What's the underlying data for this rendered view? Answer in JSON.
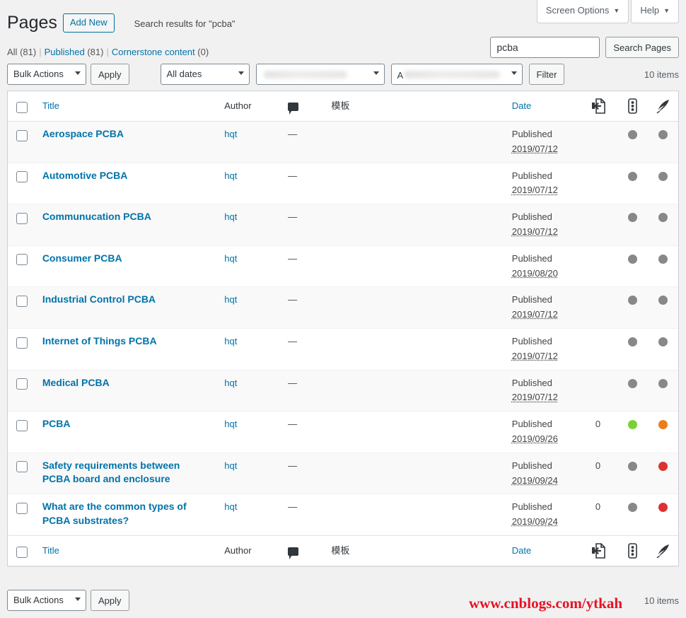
{
  "screen_meta": {
    "screen_options_label": "Screen Options",
    "help_label": "Help",
    "caret": "▼"
  },
  "header": {
    "title": "Pages",
    "add_new_label": "Add New",
    "search_result_note": "Search results for \"pcba\""
  },
  "status_links": {
    "all_label": "All",
    "all_count": "(81)",
    "published_label": "Published",
    "published_count": "(81)",
    "cornerstone_label": "Cornerstone content",
    "cornerstone_count": "(0)",
    "separator": "|"
  },
  "search": {
    "value": "pcba",
    "placeholder": "",
    "submit_label": "Search Pages"
  },
  "tablenav_top": {
    "bulk_actions_label": "Bulk Actions",
    "apply_label": "Apply",
    "all_dates_label": "All dates",
    "filter_a_label": "",
    "filter_b_label": "A",
    "filter_label": "Filter",
    "displaying_num": "10 items"
  },
  "tablenav_bottom": {
    "bulk_actions_label": "Bulk Actions",
    "apply_label": "Apply",
    "displaying_num": "10 items"
  },
  "columns": {
    "cb": "",
    "title": "Title",
    "author": "Author",
    "comments": "comment-bubble-icon",
    "template": "模板",
    "date": "Date",
    "links": "incoming-links-icon",
    "seo": "seo-score-icon",
    "readability": "readability-icon"
  },
  "colors": {
    "link": "#0073aa",
    "green": "#7ad03a",
    "orange": "#ee7c1b",
    "red": "#dc3232",
    "gray": "#888888",
    "watermark": "#e81123"
  },
  "rows": [
    {
      "title": "Aerospace PCBA",
      "author": "hqt",
      "comments": "",
      "template": "—",
      "status": "Published",
      "date": "2019/07/12",
      "links": "",
      "seo_color": "#888888",
      "read_color": "#888888"
    },
    {
      "title": "Automotive PCBA",
      "author": "hqt",
      "comments": "",
      "template": "—",
      "status": "Published",
      "date": "2019/07/12",
      "links": "",
      "seo_color": "#888888",
      "read_color": "#888888"
    },
    {
      "title": "Communucation PCBA",
      "author": "hqt",
      "comments": "",
      "template": "—",
      "status": "Published",
      "date": "2019/07/12",
      "links": "",
      "seo_color": "#888888",
      "read_color": "#888888"
    },
    {
      "title": "Consumer PCBA",
      "author": "hqt",
      "comments": "",
      "template": "—",
      "status": "Published",
      "date": "2019/08/20",
      "links": "",
      "seo_color": "#888888",
      "read_color": "#888888"
    },
    {
      "title": "Industrial Control PCBA",
      "author": "hqt",
      "comments": "",
      "template": "—",
      "status": "Published",
      "date": "2019/07/12",
      "links": "",
      "seo_color": "#888888",
      "read_color": "#888888"
    },
    {
      "title": "Internet of Things PCBA",
      "author": "hqt",
      "comments": "",
      "template": "—",
      "status": "Published",
      "date": "2019/07/12",
      "links": "",
      "seo_color": "#888888",
      "read_color": "#888888"
    },
    {
      "title": "Medical PCBA",
      "author": "hqt",
      "comments": "",
      "template": "—",
      "status": "Published",
      "date": "2019/07/12",
      "links": "",
      "seo_color": "#888888",
      "read_color": "#888888"
    },
    {
      "title": "PCBA",
      "author": "hqt",
      "comments": "",
      "template": "—",
      "status": "Published",
      "date": "2019/09/26",
      "links": "0",
      "seo_color": "#7ad03a",
      "read_color": "#ee7c1b"
    },
    {
      "title": "Safety requirements between PCBA board and enclosure",
      "author": "hqt",
      "comments": "",
      "template": "—",
      "status": "Published",
      "date": "2019/09/24",
      "links": "0",
      "seo_color": "#888888",
      "read_color": "#dc3232"
    },
    {
      "title": "What are the common types of PCBA substrates?",
      "author": "hqt",
      "comments": "",
      "template": "—",
      "status": "Published",
      "date": "2019/09/24",
      "links": "0",
      "seo_color": "#888888",
      "read_color": "#dc3232"
    }
  ],
  "watermark": {
    "text": "www.cnblogs.com/ytkah"
  }
}
